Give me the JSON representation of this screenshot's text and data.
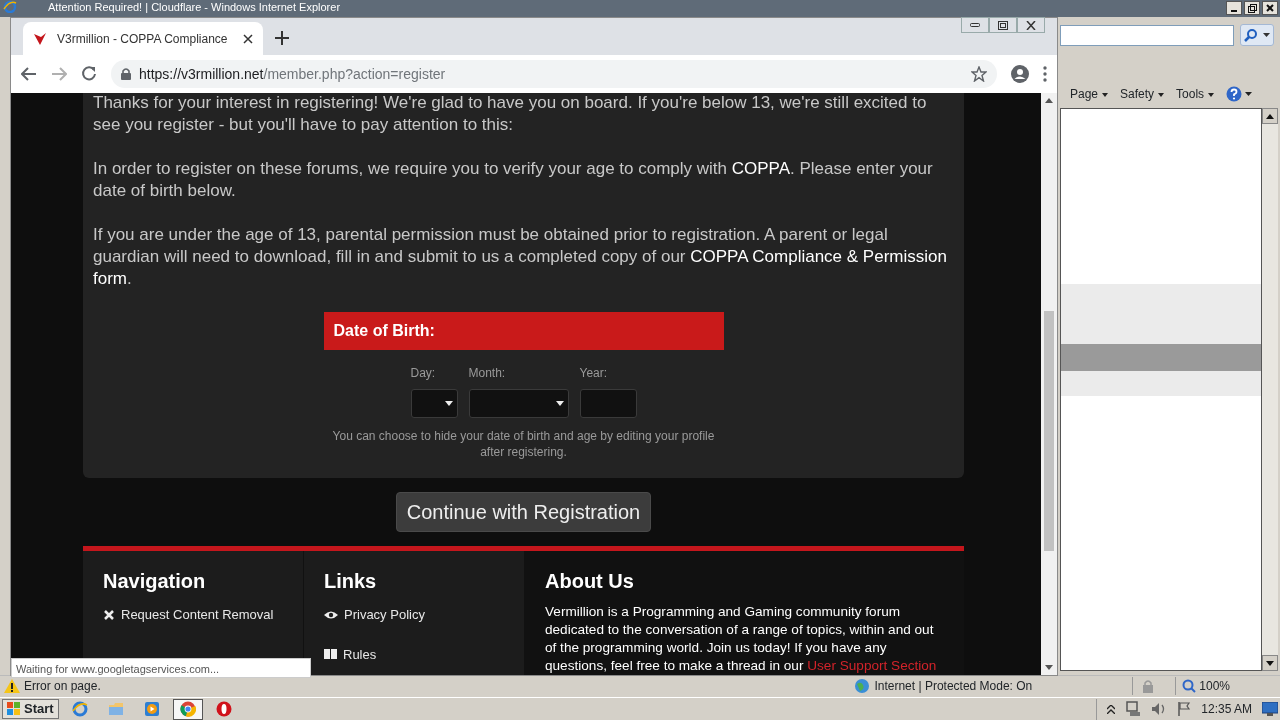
{
  "ie_window": {
    "title": "Attention Required! | Cloudflare - Windows Internet Explorer",
    "command_bar": [
      "Page",
      "Safety",
      "Tools"
    ],
    "status_bar": {
      "message": "Error on page.",
      "zone": "Internet | Protected Mode: On",
      "zoom": "100%"
    }
  },
  "browser": {
    "tabs": [
      {
        "title": "V3rmillion - COPPA Compliance",
        "selected": true
      }
    ],
    "nav_buttons": [
      {
        "kind": "back",
        "disabled": false
      },
      {
        "kind": "forward",
        "disabled": true
      },
      {
        "kind": "reload",
        "disabled": false
      }
    ],
    "url": {
      "host": "https://v3rmillion.net",
      "path": "/member.php?action=register"
    },
    "status_bubble": "Waiting for www.googletagservices.com..."
  },
  "page": {
    "paragraphs": [
      [
        {
          "kind": "text",
          "text": "Thanks for your interest in registering! We're glad to have you on board. If you're below 13, we're still excited to see you register - but you'll have to pay attention to this:"
        }
      ],
      [
        {
          "kind": "text",
          "text": "In order to register on these forums, we require you to verify your age to comply with "
        },
        {
          "kind": "link",
          "text": "COPPA"
        },
        {
          "kind": "text",
          "text": ". Please enter your date of birth below."
        }
      ],
      [
        {
          "kind": "text",
          "text": "If you are under the age of 13, parental permission must be obtained prior to registration. A parent or legal guardian will need to download, fill in and submit to us a completed copy of our "
        },
        {
          "kind": "link",
          "text": "COPPA Compliance & Permission"
        },
        {
          "kind": "link",
          "text": "form"
        },
        {
          "kind": "text",
          "text": "."
        }
      ]
    ],
    "dob": {
      "title": "Date of Birth:",
      "fields": [
        {
          "label": "Day:",
          "kind": "select"
        },
        {
          "label": "Month:",
          "kind": "select"
        },
        {
          "label": "Year:",
          "kind": "input"
        }
      ],
      "hint": "You can choose to hide your date of birth and age by editing your profile after registering."
    },
    "continue_button": "Continue with Registration",
    "footer": [
      {
        "title": "Navigation",
        "kind": "list",
        "items": [
          {
            "label": "Request Content Removal",
            "kind": "cross"
          }
        ]
      },
      {
        "title": "Links",
        "kind": "list",
        "items": [
          {
            "label": "Privacy Policy",
            "kind": "eye"
          },
          {
            "label": "Rules",
            "kind": "book"
          }
        ]
      },
      {
        "title": "About Us",
        "kind": "text",
        "text": [
          {
            "kind": "text",
            "text": "Vermillion is a Programming and Gaming community forum dedicated to the conversation of a range of topics, within and out of the programming world. Join us today! If you have any questions, feel free to make a thread in our "
          },
          {
            "kind": "link",
            "text": "User Support Section"
          }
        ]
      }
    ]
  },
  "taskbar": {
    "start": "Start",
    "apps": [
      {
        "kind": "ie",
        "selected": false
      },
      {
        "kind": "folder",
        "selected": false
      },
      {
        "kind": "media",
        "selected": false
      },
      {
        "kind": "chrome",
        "selected": true
      },
      {
        "kind": "opera",
        "selected": false
      }
    ],
    "clock": "12:35 AM"
  }
}
